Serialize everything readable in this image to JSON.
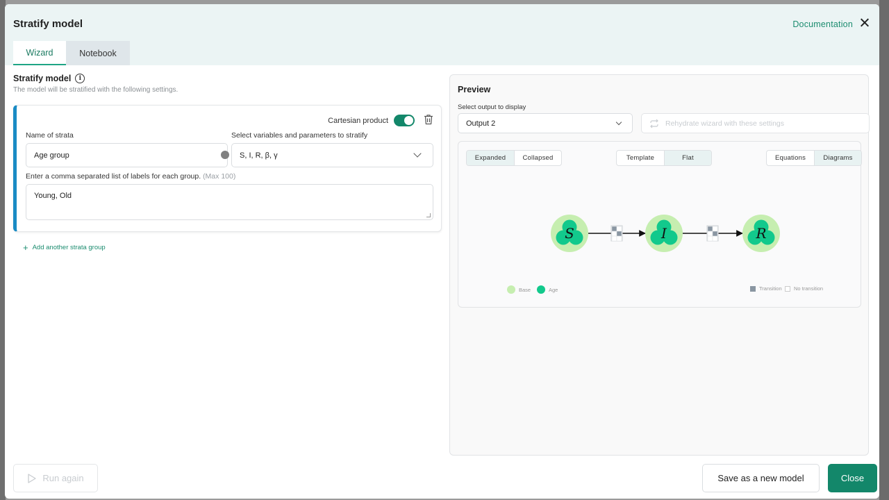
{
  "modal": {
    "title": "Stratify model",
    "documentation_link": "Documentation",
    "close_icon": "close-icon"
  },
  "tabs": [
    {
      "label": "Wizard",
      "active": true
    },
    {
      "label": "Notebook",
      "active": false
    }
  ],
  "wizard": {
    "section_title": "Stratify model",
    "section_subtitle": "The model will be stratified with the following settings.",
    "strata_card": {
      "cartesian_label": "Cartesian product",
      "cartesian_enabled": true,
      "name_label": "Name of strata",
      "name_value": "Age group",
      "variables_label": "Select variables and parameters to stratify",
      "variables_value": "S, I, R, β, γ",
      "labels_label": "Enter a comma separated list of labels for each group.",
      "labels_hint": "(Max 100)",
      "labels_value": "Young, Old"
    },
    "add_strata_label": "Add another strata group"
  },
  "preview": {
    "title": "Preview",
    "select_label": "Select output to display",
    "selected_output": "Output 2",
    "rehydrate_label": "Rehydrate wizard with these settings",
    "view_toggle_1": [
      {
        "label": "Expanded",
        "active": true
      },
      {
        "label": "Collapsed",
        "active": false
      }
    ],
    "view_toggle_2": [
      {
        "label": "Template",
        "active": false
      },
      {
        "label": "Flat",
        "active": true
      }
    ],
    "view_toggle_3": [
      {
        "label": "Equations",
        "active": false
      },
      {
        "label": "Diagrams",
        "active": true
      }
    ],
    "diagram": {
      "nodes": [
        "S",
        "I",
        "R"
      ],
      "edges": [
        [
          "S",
          "I"
        ],
        [
          "I",
          "R"
        ]
      ],
      "legend": {
        "base_label": "Base",
        "age_label": "Age",
        "transition_label": "Transition",
        "no_transition_label": "No transition"
      },
      "colors": {
        "base": "#c6eeb0",
        "age": "#12c98c",
        "transition": "#8a96a2"
      }
    }
  },
  "footer": {
    "run_again_label": "Run again",
    "save_new_label": "Save as a new model",
    "close_label": "Close"
  },
  "colors": {
    "accent": "#13876a",
    "link": "#1b8c6f",
    "card_accent": "#1a8bc4",
    "header_bg": "#ebf4f4"
  }
}
